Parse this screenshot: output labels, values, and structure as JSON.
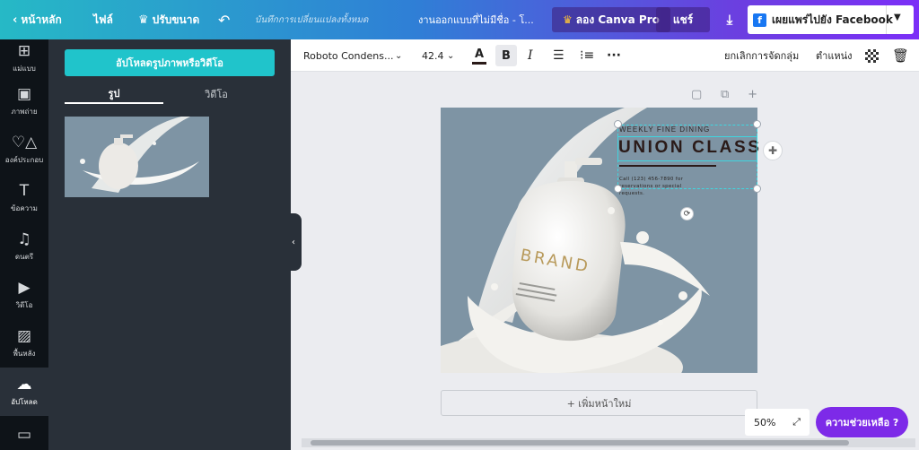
{
  "topbar": {
    "home_label": "หน้าหลัก",
    "file_label": "ไฟล์",
    "resize_label": "ปรับขนาด",
    "undo_icon": "undo-icon",
    "saved_label": "บันทึกการเปลี่ยนแปลงทั้งหมด",
    "doc_title": "งานออกแบบที่ไม่มีชื่อ - โ...",
    "pro_label": "ลอง Canva Pro",
    "share_label": "แชร์",
    "publish_label": "เผยแพร่ไปยัง Facebook",
    "gradient_start": "#26b9c6",
    "gradient_end": "#7b2ff7"
  },
  "rail": {
    "items": [
      {
        "label": "แม่แบบ",
        "icon": "template-icon"
      },
      {
        "label": "ภาพถ่าย",
        "icon": "photo-icon"
      },
      {
        "label": "องค์ประกอบ",
        "icon": "elements-icon"
      },
      {
        "label": "ข้อความ",
        "icon": "text-icon"
      },
      {
        "label": "ดนตรี",
        "icon": "music-icon"
      },
      {
        "label": "วิดีโอ",
        "icon": "video-icon"
      },
      {
        "label": "พื้นหลัง",
        "icon": "background-icon"
      },
      {
        "label": "อัปโหลด",
        "icon": "upload-icon"
      },
      {
        "label": "",
        "icon": "folder-icon"
      }
    ],
    "active_index": 7
  },
  "panel": {
    "upload_button": "อัปโหลดรูปภาพหรือวิดีโอ",
    "tabs": [
      "รูป",
      "วิดีโอ"
    ],
    "active_tab": 0,
    "accent": "#20c4cb"
  },
  "format_bar": {
    "font": "Roboto Condens...",
    "size": "42.4",
    "color_glyph": "A",
    "bold": "B",
    "italic": "I",
    "ungroup": "ยกเลิกการจัดกลุ่ม",
    "position": "ตำแหน่ง",
    "text_color": "#2a1a18"
  },
  "design": {
    "weekly": "WEEKLY FINE DINING",
    "headline": "UNION CLASS",
    "call": "Call (123) 456-7890 for reservations or special requests.",
    "brand": "BRAND",
    "background": "#7e94a4"
  },
  "canvas": {
    "add_page": "+ เพิ่มหน้าใหม่",
    "zoom": "50%",
    "help": "ความช่วยเหลือ ?"
  }
}
